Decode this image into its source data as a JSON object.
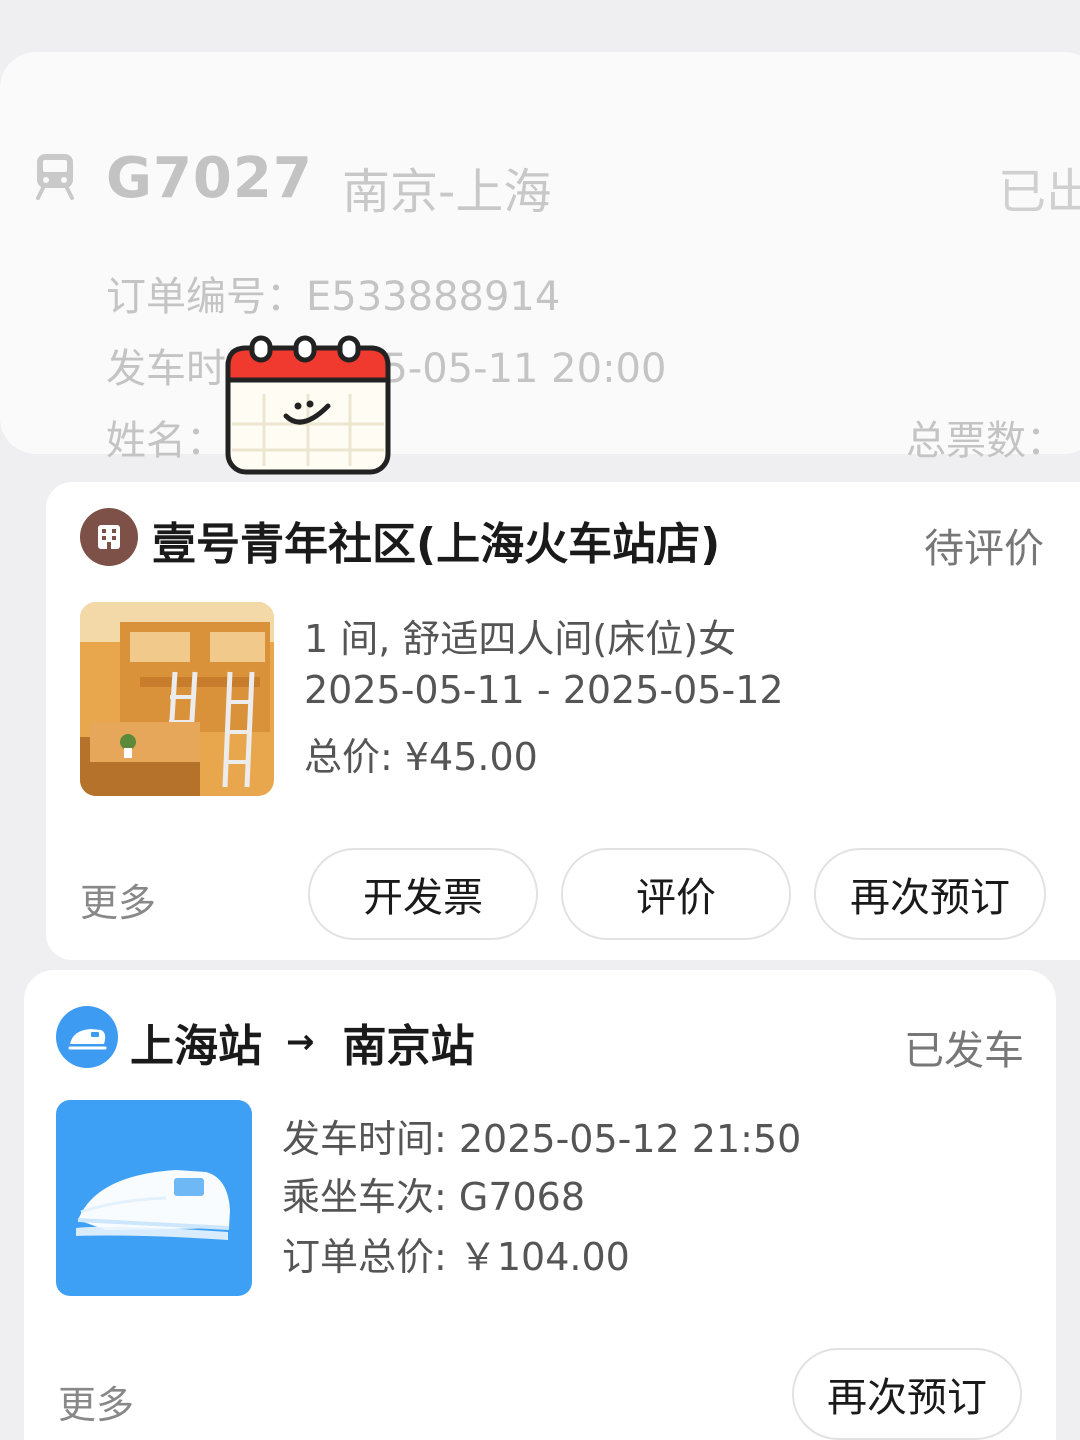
{
  "top_order": {
    "train_no": "G7027",
    "route": "南京-上海",
    "status_partial": "已出",
    "order_label": "订单编号：",
    "order_no": "E533888914",
    "depart_label": "发车时间：",
    "depart_time": "2025-05-11 20:00",
    "name_label": "姓名：",
    "tickets_label": "总票数："
  },
  "hotel_order": {
    "name": "壹号青年社区(上海火车站店)",
    "status": "待评价",
    "room": "1 间, 舒适四人间(床位)女",
    "dates": "2025-05-11 - 2025-05-12",
    "price": "总价: ¥45.00",
    "more": "更多",
    "buttons": {
      "invoice": "开发票",
      "review": "评价",
      "rebook": "再次预订"
    }
  },
  "train_order": {
    "from": "上海站",
    "arrow": "→",
    "to": "南京站",
    "status": "已发车",
    "depart": "发车时间: 2025-05-12 21:50",
    "train_no": "乘坐车次: G7068",
    "total": "订单总价: ￥104.00",
    "more": "更多",
    "rebook": "再次预订"
  },
  "colors": {
    "background": "#efeff1",
    "hotel_badge": "#7d5147",
    "train_blue": "#3d9cf2",
    "calendar_red": "#f0392f"
  },
  "icons": {
    "top_train": "train-icon",
    "hotel": "hotel-building-icon",
    "train": "high-speed-train-icon",
    "sticker": "calendar-smile-sticker"
  }
}
